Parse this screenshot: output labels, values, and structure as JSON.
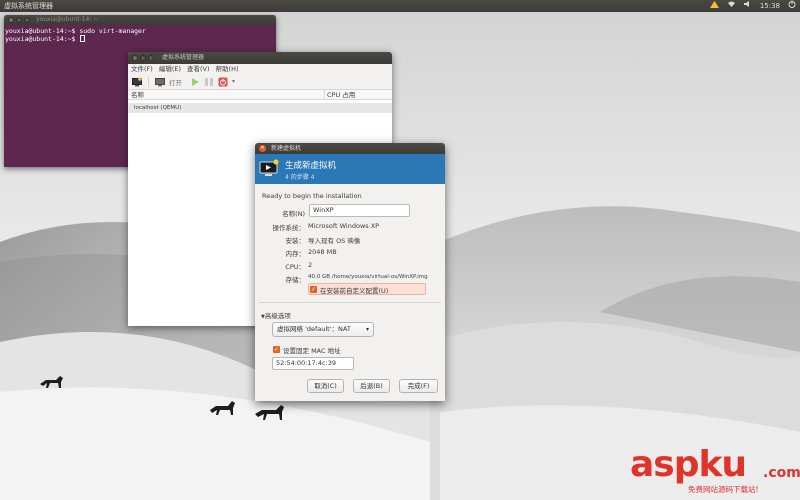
{
  "top_panel": {
    "app_title": "虚拟系统管理器",
    "clock": "15:38",
    "indicators": [
      "network-icon",
      "wifi-icon",
      "volume-icon",
      "power-icon"
    ]
  },
  "terminal": {
    "title": "youxia@ubunt-14: ~",
    "lines": [
      "youxia@ubunt-14:~$ sudo virt-manager",
      "youxia@ubunt-14:~$ "
    ],
    "background": "#5e2750"
  },
  "virt_manager": {
    "title": "虚拟系统管理器",
    "menu": [
      "文件(F)",
      "编辑(E)",
      "查看(V)",
      "帮助(H)"
    ],
    "toolbar": {
      "open_label": "打开"
    },
    "columns": [
      "名称",
      "CPU 占用"
    ],
    "rows": [
      "localhost (QEMU)"
    ]
  },
  "dialog": {
    "title": "新建虚拟机",
    "header_title": "生成新虚拟机",
    "header_step": "4 的步骤 4",
    "header_color": "#2a78b6",
    "intro": "Ready to begin the installation",
    "name_label": "名称(N)",
    "name_value": "WinXP",
    "os_label": "操作系统：",
    "os_value": "Microsoft Windows XP",
    "install_label": "安装：",
    "install_value": "导入现有 OS 映像",
    "memory_label": "内存：",
    "memory_value": "2048 MB",
    "cpu_label": "CPU：",
    "cpu_value": "2",
    "storage_label": "存储：",
    "storage_value": "40.0 GB /home/youxia/virtual-os/WinXP.img",
    "customize_label": "在安装前自定义配置(U)",
    "customize_checked": true,
    "advanced_label": "高级选项",
    "network_value": "虚拟网络 'default'：NAT",
    "fixed_mac_label": "设置固定 MAC 地址",
    "fixed_mac_checked": true,
    "mac_value": "52:54:00:17:4c:39",
    "cancel_label": "取消(C)",
    "back_label": "后退(B)",
    "finish_label": "完成(F)",
    "accent": "#e0632c"
  },
  "watermark": {
    "brand": "aspku",
    "tld": ".com",
    "tagline": "免费网站源码下载站!"
  }
}
